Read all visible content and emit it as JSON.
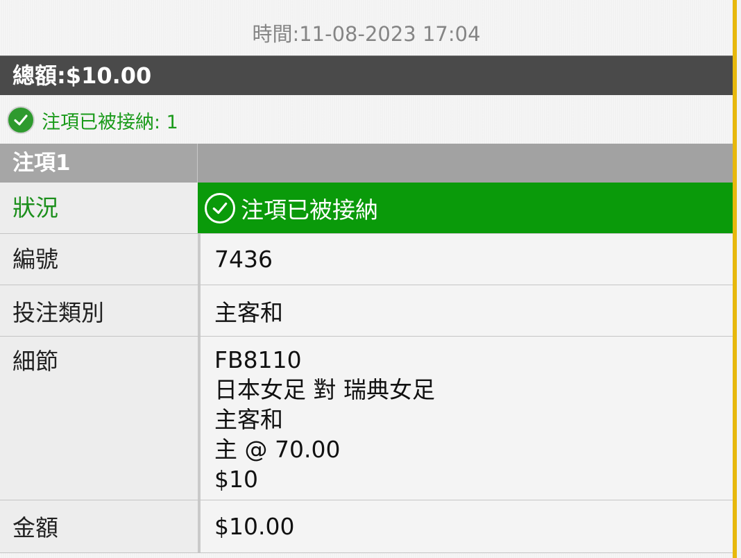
{
  "header": {
    "time_text": "時間:11-08-2023 17:04",
    "total_text": "總額:$10.00"
  },
  "summary": {
    "accepted_text": "注項已被接納: 1",
    "icon": "check-circle-icon"
  },
  "bet": {
    "title": "注項1",
    "rows": {
      "status_label": "狀況",
      "status_value": "注項已被接納",
      "number_label": "編號",
      "number_value": "7436",
      "type_label": "投注類別",
      "type_value": "主客和",
      "details_label": "細節",
      "details_lines": [
        "FB8110",
        "日本女足 對 瑞典女足",
        "主客和",
        "主 @ 70.00",
        "$10"
      ],
      "amount_label": "金額",
      "amount_value": "$10.00"
    }
  },
  "colors": {
    "accent_green": "#0a9a0a",
    "scroll_thumb": "#e7b80d",
    "header_bar": "#4a4a4a"
  }
}
